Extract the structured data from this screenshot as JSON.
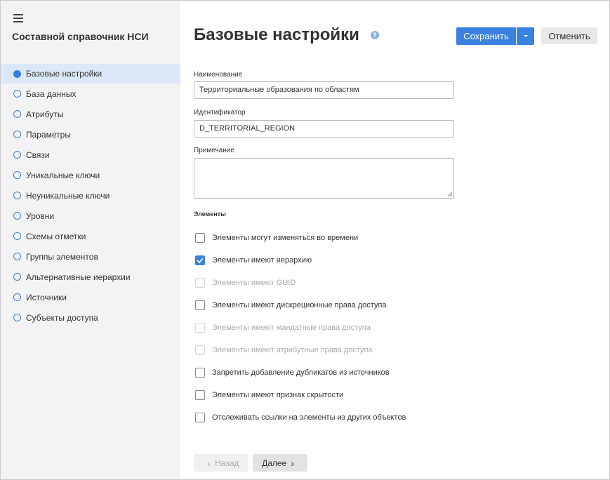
{
  "app": {
    "title": "Составной справочник НСИ"
  },
  "sidebar": {
    "items": [
      {
        "label": "Базовые настройки",
        "active": true
      },
      {
        "label": "База данных"
      },
      {
        "label": "Атрибуты"
      },
      {
        "label": "Параметры"
      },
      {
        "label": "Связи"
      },
      {
        "label": "Уникальные ключи"
      },
      {
        "label": "Неуникальные ключи"
      },
      {
        "label": "Уровни"
      },
      {
        "label": "Схемы отметки"
      },
      {
        "label": "Группы элементов"
      },
      {
        "label": "Альтернативные иерархии"
      },
      {
        "label": "Источники"
      },
      {
        "label": "Субъекты доступа"
      }
    ]
  },
  "header": {
    "title": "Базовые настройки",
    "help_icon": "?",
    "save_label": "Сохранить",
    "cancel_label": "Отменить"
  },
  "form": {
    "name_label": "Наименование",
    "name_value": "Территориальные образования по областям",
    "id_label": "Идентификатор",
    "id_value": "D_TERRITORIAL_REGION",
    "note_label": "Примечание",
    "note_value": ""
  },
  "elements": {
    "title": "Элементы",
    "options": [
      {
        "label": "Элементы могут изменяться во времени",
        "checked": false,
        "disabled": false
      },
      {
        "label": "Элементы имеют иерархию",
        "checked": true,
        "disabled": false
      },
      {
        "label": "Элементы имеют GUID",
        "checked": false,
        "disabled": true
      },
      {
        "label": "Элементы имеют дискреционные права доступа",
        "checked": false,
        "disabled": false
      },
      {
        "label": "Элементы имеют мандатные права доступа",
        "checked": false,
        "disabled": true
      },
      {
        "label": "Элементы имеют атрибутные права доступа",
        "checked": false,
        "disabled": true
      },
      {
        "label": "Запретить добавление дубликатов из источников",
        "checked": false,
        "disabled": false
      },
      {
        "label": "Элементы имеют признак скрытости",
        "checked": false,
        "disabled": false
      },
      {
        "label": "Отслеживать ссылки на элементы из других объектов",
        "checked": false,
        "disabled": false
      }
    ]
  },
  "footer": {
    "back_label": "Назад",
    "next_label": "Далее"
  },
  "colors": {
    "accent": "#3b82e0",
    "sidebar_bg": "#f3f3f3",
    "active_bg": "#dbe8f7"
  }
}
